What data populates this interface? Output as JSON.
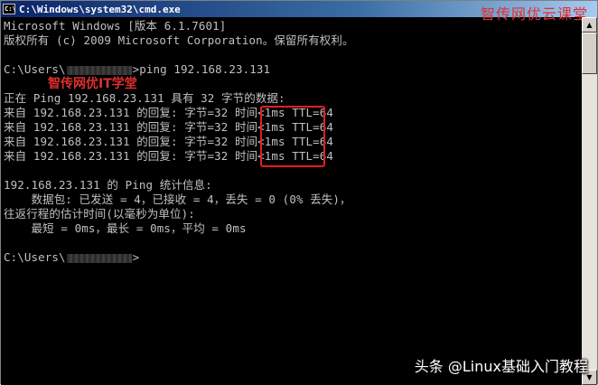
{
  "window": {
    "title": "C:\\Windows\\system32\\cmd.exe",
    "icon_label": "C:\\"
  },
  "watermarks": {
    "top_right": "智传网优云课堂",
    "inline": "智传网优IT学堂",
    "footer": "头条 @Linux基础入门教程"
  },
  "console": {
    "line_1": "Microsoft Windows [版本 6.1.7601]",
    "line_2": "版权所有 (c) 2009 Microsoft Corporation。保留所有权利。",
    "prompt_1_prefix": "C:\\Users\\",
    "prompt_1_cmd": ">ping 192.168.23.131",
    "ping_header": "正在 Ping 192.168.23.131 具有 32 字节的数据:",
    "replies": [
      "来自 192.168.23.131 的回复: 字节=32 时间<1ms TTL=64",
      "来自 192.168.23.131 的回复: 字节=32 时间<1ms TTL=64",
      "来自 192.168.23.131 的回复: 字节=32 时间<1ms TTL=64",
      "来自 192.168.23.131 的回复: 字节=32 时间<1ms TTL=64"
    ],
    "stats_header": "192.168.23.131 的 Ping 统计信息:",
    "stats_packets": "    数据包: 已发送 = 4，已接收 = 4，丢失 = 0 (0% 丢失)，",
    "stats_rtt_header": "往返行程的估计时间(以毫秒为单位):",
    "stats_rtt": "    最短 = 0ms，最长 = 0ms，平均 = 0ms",
    "prompt_2_prefix": "C:\\Users\\",
    "prompt_2_suffix": ">"
  },
  "scrollbar": {
    "up_glyph": "▲",
    "down_glyph": "▼"
  }
}
